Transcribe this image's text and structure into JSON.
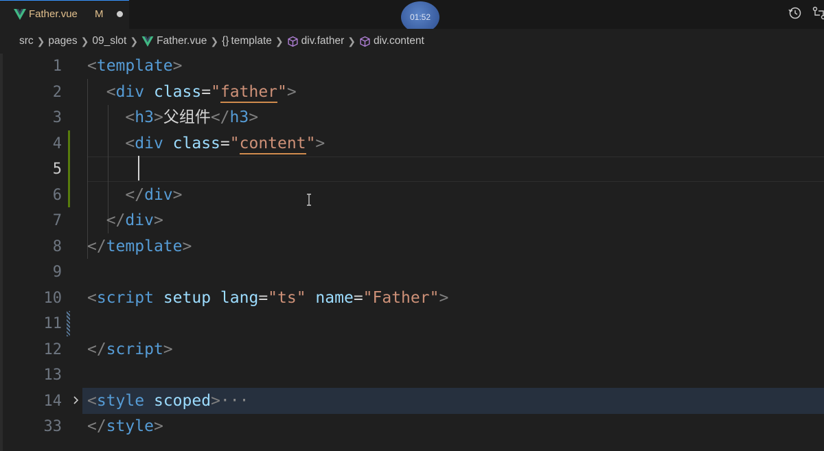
{
  "tab": {
    "filename": "Father.vue",
    "status": "M",
    "icon": "vue-icon",
    "dirty_indicator": "unsaved-dot"
  },
  "overlay": {
    "timer": "01:52"
  },
  "toolbar_right": {
    "icons": [
      "history-icon",
      "git-compare-icon"
    ]
  },
  "breadcrumb": {
    "items": [
      {
        "label": "src",
        "icon": ""
      },
      {
        "label": "pages",
        "icon": ""
      },
      {
        "label": "09_slot",
        "icon": ""
      },
      {
        "label": "Father.vue",
        "icon": "vue-icon"
      },
      {
        "label": "template",
        "icon": "braces-icon",
        "glyph": "{}"
      },
      {
        "label": "div.father",
        "icon": "cube-icon"
      },
      {
        "label": "div.content",
        "icon": "cube-icon"
      }
    ]
  },
  "editor": {
    "active_line": "5",
    "lines": [
      {
        "num": "1",
        "segments": [
          [
            "tag-bracket",
            "<"
          ],
          [
            "tag-name",
            "template"
          ],
          [
            "tag-bracket",
            ">"
          ]
        ]
      },
      {
        "num": "2",
        "segments": [
          [
            "text",
            "  "
          ],
          [
            "tag-bracket",
            "<"
          ],
          [
            "tag-name",
            "div"
          ],
          [
            "text",
            " "
          ],
          [
            "attr",
            "class"
          ],
          [
            "text",
            "="
          ],
          [
            "str",
            "\""
          ],
          [
            "str u",
            "father"
          ],
          [
            "str",
            "\""
          ],
          [
            "tag-bracket",
            ">"
          ]
        ]
      },
      {
        "num": "3",
        "segments": [
          [
            "text",
            "    "
          ],
          [
            "tag-bracket",
            "<"
          ],
          [
            "tag-name",
            "h3"
          ],
          [
            "tag-bracket",
            ">"
          ],
          [
            "text",
            "父组件"
          ],
          [
            "tag-bracket",
            "</"
          ],
          [
            "tag-name",
            "h3"
          ],
          [
            "tag-bracket",
            ">"
          ]
        ]
      },
      {
        "num": "4",
        "segments": [
          [
            "text",
            "    "
          ],
          [
            "tag-bracket",
            "<"
          ],
          [
            "tag-name",
            "div"
          ],
          [
            "text",
            " "
          ],
          [
            "attr",
            "class"
          ],
          [
            "text",
            "="
          ],
          [
            "str",
            "\""
          ],
          [
            "str u",
            "content"
          ],
          [
            "str",
            "\""
          ],
          [
            "tag-bracket",
            ">"
          ]
        ]
      },
      {
        "num": "5",
        "segments": [
          [
            "text",
            ""
          ]
        ]
      },
      {
        "num": "6",
        "segments": [
          [
            "text",
            "    "
          ],
          [
            "tag-bracket",
            "</"
          ],
          [
            "tag-name",
            "div"
          ],
          [
            "tag-bracket",
            ">"
          ]
        ]
      },
      {
        "num": "7",
        "segments": [
          [
            "text",
            "  "
          ],
          [
            "tag-bracket",
            "</"
          ],
          [
            "tag-name",
            "div"
          ],
          [
            "tag-bracket",
            ">"
          ]
        ]
      },
      {
        "num": "8",
        "segments": [
          [
            "tag-bracket",
            "</"
          ],
          [
            "tag-name",
            "template"
          ],
          [
            "tag-bracket",
            ">"
          ]
        ]
      },
      {
        "num": "9",
        "segments": [
          [
            "text",
            ""
          ]
        ]
      },
      {
        "num": "10",
        "segments": [
          [
            "tag-bracket",
            "<"
          ],
          [
            "tag-name",
            "script"
          ],
          [
            "text",
            " "
          ],
          [
            "attr",
            "setup"
          ],
          [
            "text",
            " "
          ],
          [
            "attr",
            "lang"
          ],
          [
            "text",
            "="
          ],
          [
            "str",
            "\"ts\""
          ],
          [
            "text",
            " "
          ],
          [
            "attr",
            "name"
          ],
          [
            "text",
            "="
          ],
          [
            "str",
            "\"Father\""
          ],
          [
            "tag-bracket",
            ">"
          ]
        ]
      },
      {
        "num": "11",
        "segments": [
          [
            "text",
            ""
          ]
        ]
      },
      {
        "num": "12",
        "segments": [
          [
            "tag-bracket",
            "</"
          ],
          [
            "tag-name",
            "script"
          ],
          [
            "tag-bracket",
            ">"
          ]
        ]
      },
      {
        "num": "13",
        "segments": [
          [
            "text",
            ""
          ]
        ]
      },
      {
        "num": "14",
        "segments": [
          [
            "tag-bracket",
            "<"
          ],
          [
            "tag-name",
            "style"
          ],
          [
            "text",
            " "
          ],
          [
            "attr",
            "scoped"
          ],
          [
            "tag-bracket",
            ">"
          ],
          [
            "fold-dots",
            "···"
          ]
        ]
      },
      {
        "num": "33",
        "segments": [
          [
            "tag-bracket",
            "</"
          ],
          [
            "tag-name",
            "style"
          ],
          [
            "tag-bracket",
            ">"
          ]
        ]
      }
    ]
  },
  "colors": {
    "background": "#1f1f1f",
    "tag": "#569cd6",
    "attribute": "#9cdcfe",
    "string": "#ce9178",
    "bracket": "#808080",
    "modified_file": "#e2c08d",
    "gutter_modified": "#587c0c"
  }
}
